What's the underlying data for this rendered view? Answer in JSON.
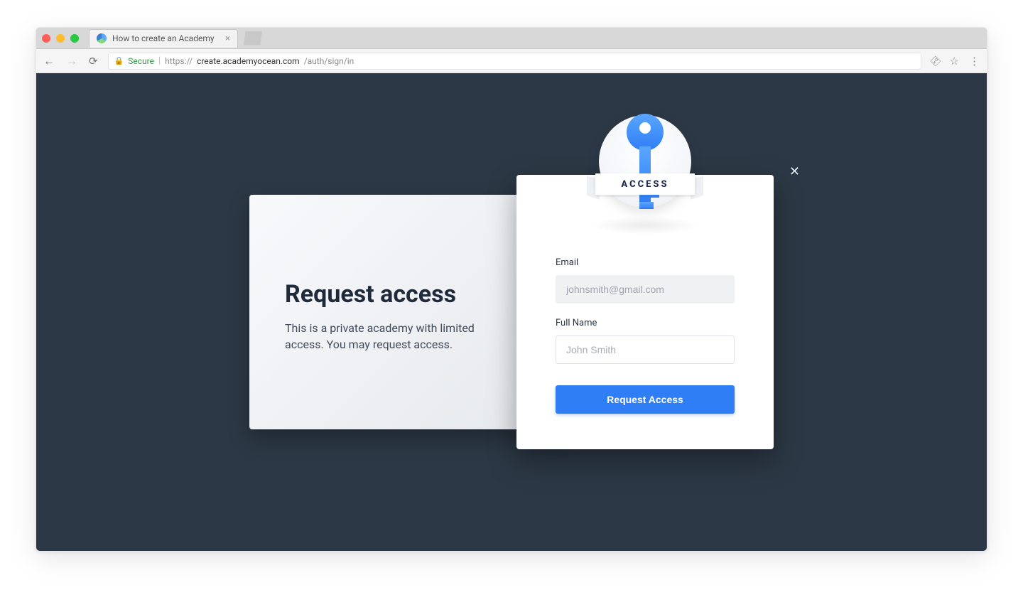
{
  "browser": {
    "tab_title": "How to create an Academy",
    "secure_label": "Secure",
    "url_scheme": "https://",
    "url_host": "create.academyocean.com",
    "url_path": "/auth/sign/in"
  },
  "info": {
    "title": "Request access",
    "description": "This is a private academy with limited access. You may request access."
  },
  "badge": {
    "label": "ACCESS"
  },
  "form": {
    "email_label": "Email",
    "email_value": "johnsmith@gmail.com",
    "fullname_label": "Full Name",
    "fullname_placeholder": "John Smith",
    "submit_label": "Request Access"
  }
}
